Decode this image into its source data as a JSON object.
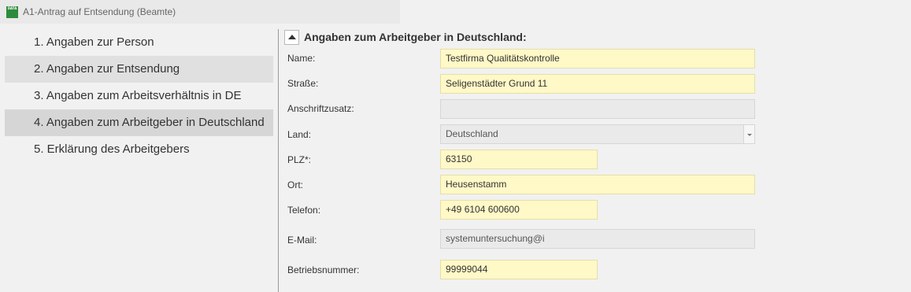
{
  "window": {
    "title": "A1-Antrag auf Entsendung (Beamte)",
    "icon_text": "DATA"
  },
  "nav": {
    "items": [
      {
        "label": "1. Angaben zur Person"
      },
      {
        "label": "2. Angaben zur Entsendung"
      },
      {
        "label": "3. Angaben zum Arbeitsverhältnis in DE"
      },
      {
        "label": "4. Angaben zum Arbeitgeber in Deutschland"
      },
      {
        "label": "5. Erklärung des Arbeitgebers"
      }
    ],
    "selected_index": 3
  },
  "section": {
    "title": "Angaben zum Arbeitgeber in Deutschland:"
  },
  "form": {
    "name": {
      "label": "Name:",
      "value": "Testfirma Qualitätskontrolle"
    },
    "strasse": {
      "label": "Straße:",
      "value": "Seligenstädter Grund 11"
    },
    "anschriftzusatz": {
      "label": "Anschriftzusatz:",
      "value": ""
    },
    "land": {
      "label": "Land:",
      "value": "Deutschland"
    },
    "plz": {
      "label": "PLZ*:",
      "value": "63150"
    },
    "ort": {
      "label": "Ort:",
      "value": "Heusenstamm"
    },
    "telefon": {
      "label": "Telefon:",
      "value": "+49 6104 600600"
    },
    "email": {
      "label": "E-Mail:",
      "value": "systemuntersuchung@i"
    },
    "betriebsnummer": {
      "label": "Betriebsnummer:",
      "value": "99999044"
    }
  },
  "colors": {
    "required_field_bg": "#fff8c7",
    "readonly_field_bg": "#eaeaea",
    "selected_nav_bg": "#d6d6d6",
    "app_icon": "#2e8b3d"
  }
}
